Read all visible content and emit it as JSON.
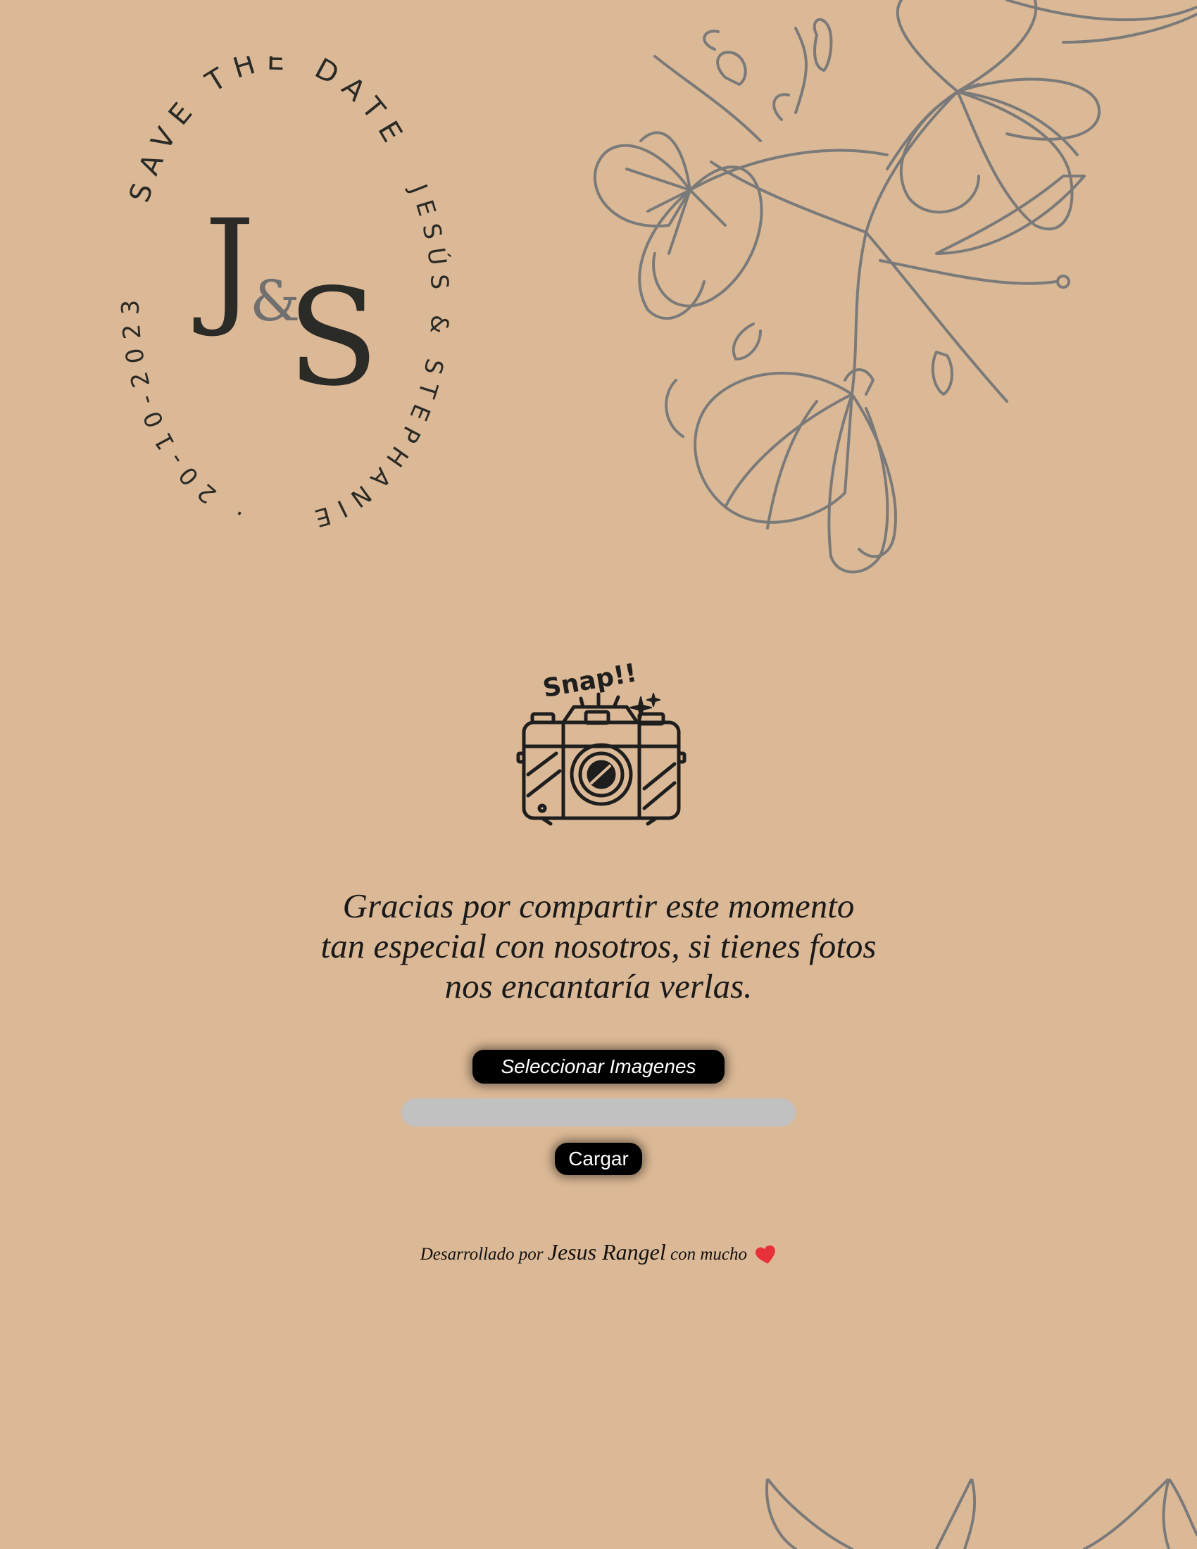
{
  "seal": {
    "ring_top": "SAVE THE DATE ·",
    "ring_names": "JESÚS & STEPHANIE",
    "ring_date": "· 20-10-2023 ·",
    "initial_left": "J",
    "ampersand": "&",
    "initial_right": "S"
  },
  "camera": {
    "snap_text": "Snap!!"
  },
  "message": {
    "line1": "Gracias por compartir este momento",
    "line2": "tan especial con nosotros, si tienes fotos",
    "line3": "nos encantaría verlas."
  },
  "buttons": {
    "select_label": "Seleccionar Imagenes",
    "upload_label": "Cargar"
  },
  "upload_progress": 0,
  "footer": {
    "prefix": "Desarrollado por",
    "author": "Jesus Rangel",
    "suffix": "con mucho"
  },
  "colors": {
    "background": "#dcb996",
    "flower_stroke": "#7a7a7a",
    "seal_text": "#2a2a26",
    "progress_track": "#c2c1c1",
    "heart": "#e8303a"
  },
  "icons": [
    "camera-icon",
    "heart-icon",
    "flower-illustration"
  ]
}
